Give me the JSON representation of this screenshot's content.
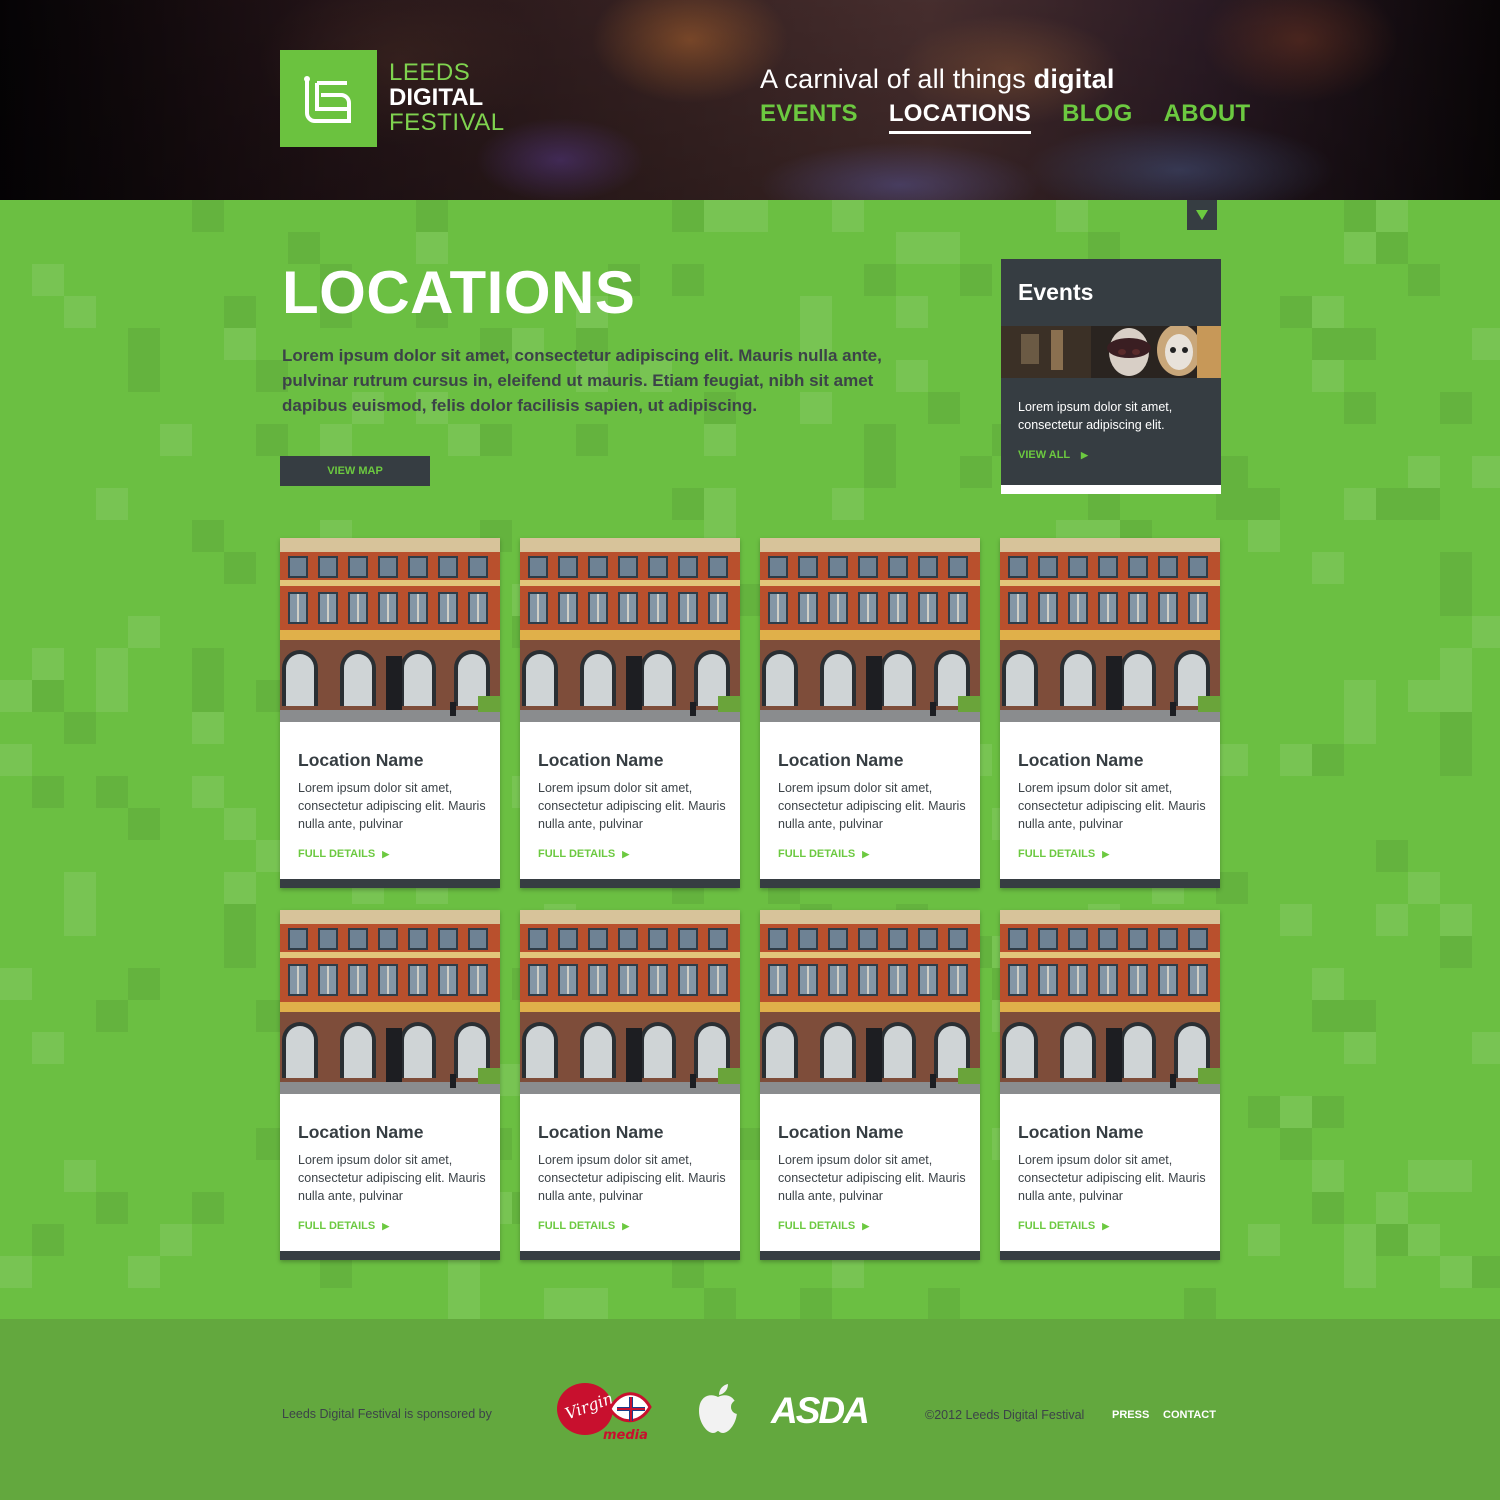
{
  "header": {
    "logo_lines": [
      "LEEDS",
      "DIGITAL",
      "FESTIVAL"
    ],
    "tagline_prefix": "A carnival of all things",
    "tagline_emphasis": "digital",
    "nav": [
      {
        "label": "EVENTS",
        "active": false
      },
      {
        "label": "LOCATIONS",
        "active": true
      },
      {
        "label": "BLOG",
        "active": false
      },
      {
        "label": "ABOUT",
        "active": false
      }
    ]
  },
  "main": {
    "title": "LOCATIONS",
    "intro": "Lorem ipsum dolor sit amet, consectetur adipiscing elit. Mauris nulla ante, pulvinar rutrum cursus in, eleifend ut mauris. Etiam feugiat, nibh sit amet dapibus euismod, felis dolor facilisis sapien, ut adipiscing.",
    "view_map_label": "VIEW MAP",
    "toggle_icon": "triangle-down-icon"
  },
  "events_box": {
    "title": "Events",
    "description": "Lorem ipsum dolor sit amet, consectetur adipiscing elit.",
    "view_all_label": "VIEW ALL",
    "view_all_icon": "play-arrow-icon"
  },
  "locations": [
    {
      "name": "Location Name",
      "description": "Lorem ipsum dolor sit amet, consectetur adipiscing elit. Mauris nulla ante, pulvinar",
      "link": "FULL DETAILS"
    },
    {
      "name": "Location Name",
      "description": "Lorem ipsum dolor sit amet, consectetur adipiscing elit. Mauris nulla ante, pulvinar",
      "link": "FULL DETAILS"
    },
    {
      "name": "Location Name",
      "description": "Lorem ipsum dolor sit amet, consectetur adipiscing elit. Mauris nulla ante, pulvinar",
      "link": "FULL DETAILS"
    },
    {
      "name": "Location Name",
      "description": "Lorem ipsum dolor sit amet, consectetur adipiscing elit. Mauris nulla ante, pulvinar",
      "link": "FULL DETAILS"
    },
    {
      "name": "Location Name",
      "description": "Lorem ipsum dolor sit amet, consectetur adipiscing elit. Mauris nulla ante, pulvinar",
      "link": "FULL DETAILS"
    },
    {
      "name": "Location Name",
      "description": "Lorem ipsum dolor sit amet, consectetur adipiscing elit. Mauris nulla ante, pulvinar",
      "link": "FULL DETAILS"
    },
    {
      "name": "Location Name",
      "description": "Lorem ipsum dolor sit amet, consectetur adipiscing elit. Mauris nulla ante, pulvinar",
      "link": "FULL DETAILS"
    },
    {
      "name": "Location Name",
      "description": "Lorem ipsum dolor sit amet, consectetur adipiscing elit. Mauris nulla ante, pulvinar",
      "link": "FULL DETAILS"
    }
  ],
  "footer": {
    "sponsor_text": "Leeds Digital Festival is sponsored by",
    "sponsors": [
      "Virgin media",
      "Apple",
      "ASDA"
    ],
    "copyright": "©2012 Leeds Digital Festival",
    "links": [
      "PRESS",
      "CONTACT"
    ]
  },
  "colors": {
    "brand_green": "#6bbf42",
    "accent_green": "#6cc940",
    "dark_slate": "#363d42",
    "footer_green": "#63a83e"
  }
}
